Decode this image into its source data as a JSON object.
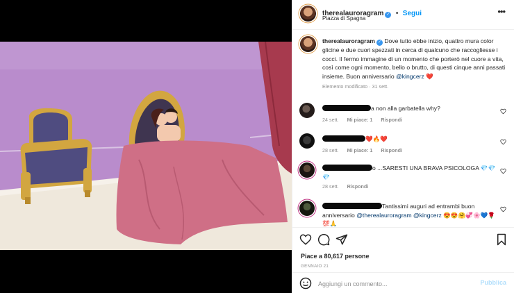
{
  "post": {
    "username": "therealauroragram",
    "follow_label": "Segui",
    "location": "Piazza di Spagna",
    "more_label": "•••"
  },
  "caption": {
    "username": "therealauroragram",
    "text": "Dove tutto ebbe inizio, quattro mura color glicine e due cuori spezzati in cerca di qualcuno che raccogliesse i cocci. Il fermo immagine di un momento che porterò nel cuore a vita, così come ogni momento, bello o brutto, di questi cinque anni passati insieme. Buon anniversario",
    "mention": "@kingcerz",
    "emoji": "❤️",
    "meta": "Elemento modificato · 31 sett."
  },
  "comments": [
    {
      "text": "a non alla garbatella why?",
      "time": "24 sett.",
      "likes": "Mi piace: 1",
      "reply": "Rispondi"
    },
    {
      "text": "❤️🔥❤️",
      "time": "28 sett.",
      "likes": "Mi piace: 1",
      "reply": "Rispondi"
    },
    {
      "text": "o ...SARESTI UNA BRAVA PSICOLOGA 💎💎💎",
      "time": "28 sett.",
      "reply": "Rispondi"
    },
    {
      "text_before": "Tantissimi auguri ad entrambi buon anniversario",
      "mention1": "@therealauroragram",
      "mention2": "@kingcerz",
      "text_after": "😍😍🤗💞🌸💙🌹💯🙏"
    }
  ],
  "footer": {
    "likes": "Piace a 80,617 persone",
    "date": "GENNAIO 21",
    "comment_placeholder": "Aggiungi un commento...",
    "publish_label": "Pubblica"
  },
  "colors": {
    "accent": "#0095f6",
    "verified": "#3897f0",
    "wall": "#b98ccc",
    "bedcover": "#cf6f86",
    "chair": "#4f4c80",
    "gold": "#d2a640",
    "curtain": "#a73a4e"
  }
}
